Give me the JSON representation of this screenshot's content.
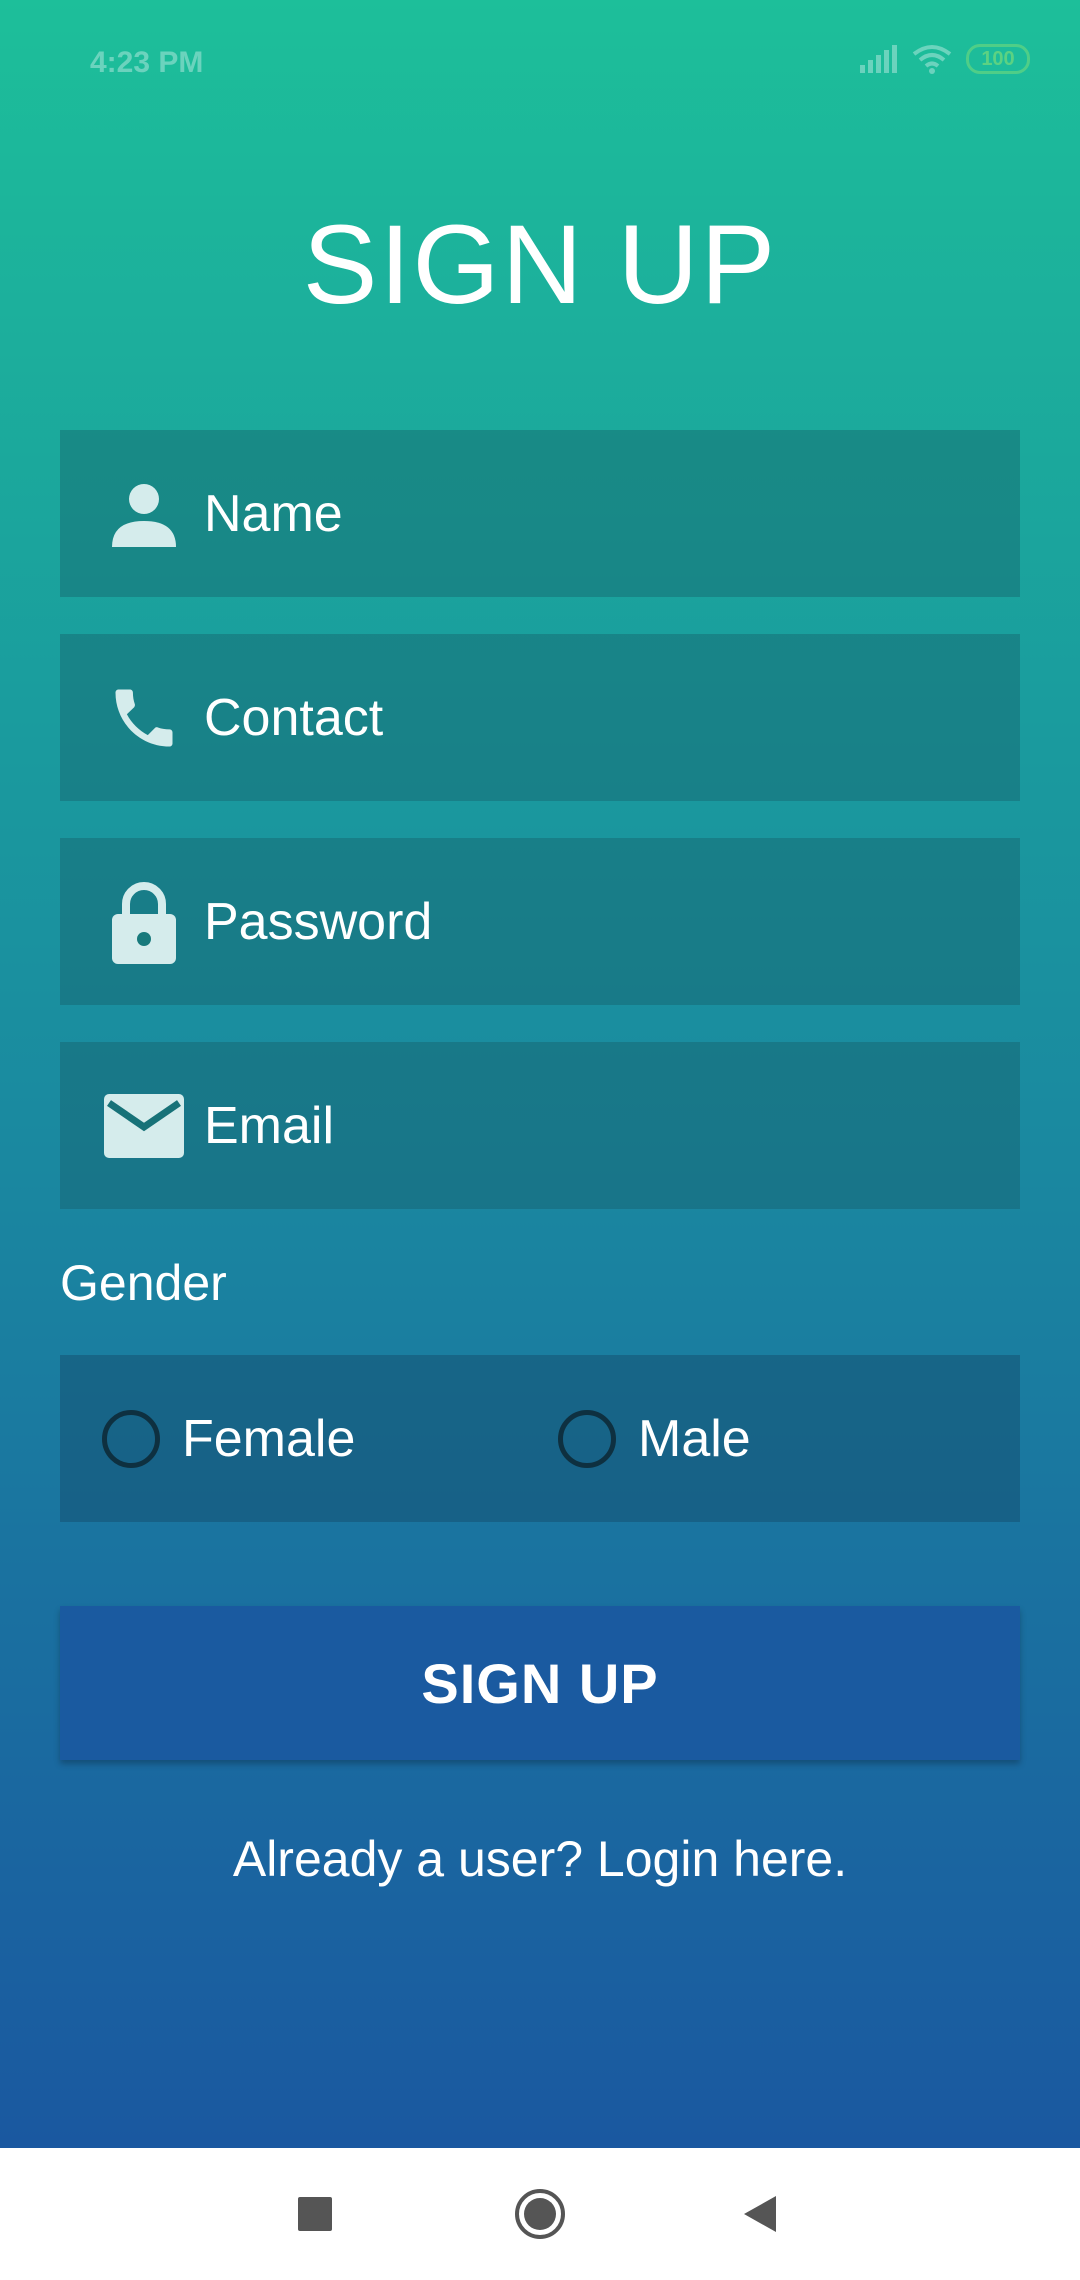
{
  "status_bar": {
    "time": "4:23 PM",
    "battery": "100",
    "icons": [
      "signal-icon",
      "wifi-icon",
      "battery-icon"
    ]
  },
  "title": "SIGN UP",
  "fields": {
    "name": {
      "placeholder": "Name",
      "icon": "person-icon"
    },
    "contact": {
      "placeholder": "Contact",
      "icon": "phone-icon"
    },
    "password": {
      "placeholder": "Password",
      "icon": "lock-icon"
    },
    "email": {
      "placeholder": "Email",
      "icon": "mail-icon"
    }
  },
  "gender": {
    "label": "Gender",
    "options": [
      "Female",
      "Male"
    ]
  },
  "signup_button": "SIGN UP",
  "login_link": "Already a user? Login here.",
  "nav": [
    "recents-button",
    "home-button",
    "back-button"
  ],
  "colors": {
    "gradient_top": "#1dbf9a",
    "gradient_bottom": "#1a58a0",
    "button": "#1a5aa0",
    "icon": "#d5ecec"
  }
}
